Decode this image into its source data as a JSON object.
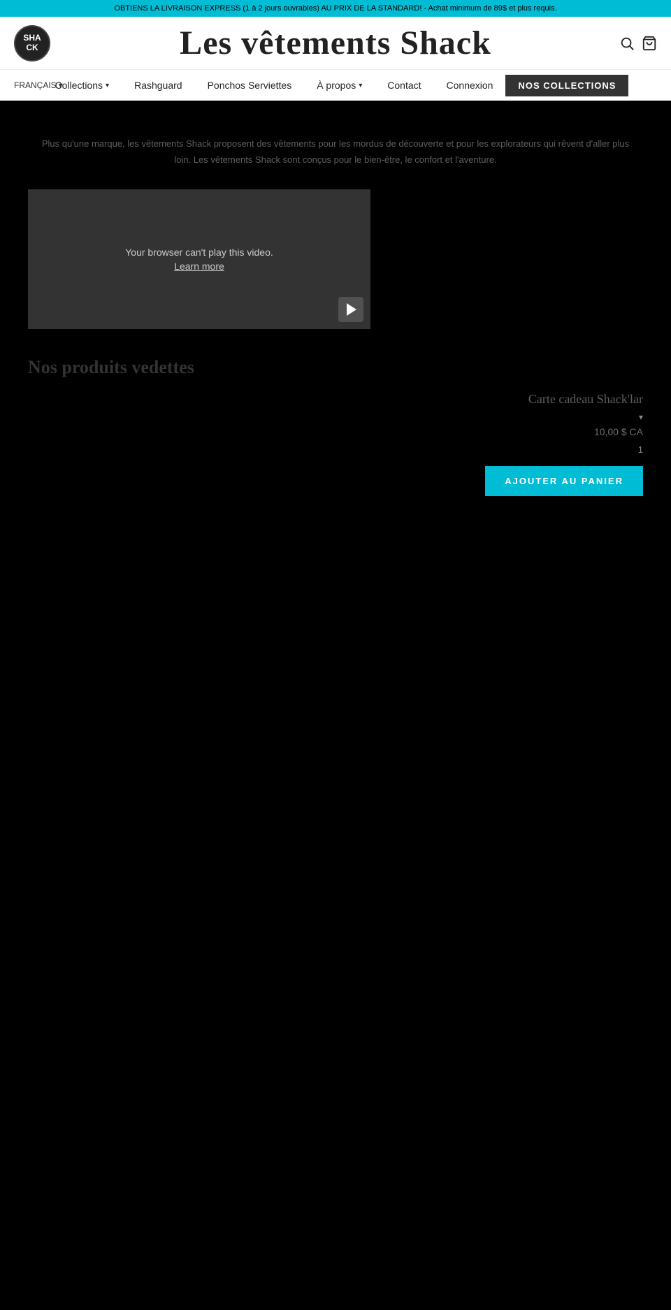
{
  "banner": {
    "text": "OBTIENS LA LIVRAISON EXPRESS (1 à 2 jours ouvrables) AU PRIX DE LA STANDARD! - Achat minimum de 89$ et plus requis."
  },
  "header": {
    "logo_text": "SHA\nCK",
    "site_title": "Les vêtements Shack"
  },
  "nav": {
    "language": "FRANÇAIS",
    "links": [
      {
        "label": "Collections",
        "has_dropdown": true
      },
      {
        "label": "Rashguard",
        "has_dropdown": false
      },
      {
        "label": "Ponchos Serviettes",
        "has_dropdown": false
      },
      {
        "label": "À propos",
        "has_dropdown": true
      },
      {
        "label": "Contact",
        "has_dropdown": false
      },
      {
        "label": "Connexion",
        "has_dropdown": false
      }
    ],
    "collections_btn": "NOS COLLECTIONS"
  },
  "description": {
    "text": "Plus qu'une marque, les vêtements Shack proposent des vêtements pour les mordus de découverte et pour les explorateurs qui rêvent d'aller plus loin. Les vêtements Shack sont conçus pour le bien-être, le confort et l'aventure."
  },
  "video": {
    "cant_play_message": "Your browser can't play this video.",
    "learn_more_label": "Learn more"
  },
  "bestsellers": {
    "section_title": "Nos produits vedettes"
  },
  "product": {
    "name": "Carte cadeau Shack'lar",
    "price": "10,00 $ CA",
    "quantity": "1",
    "add_to_cart_label": "AJOUTER AU PANIER"
  }
}
